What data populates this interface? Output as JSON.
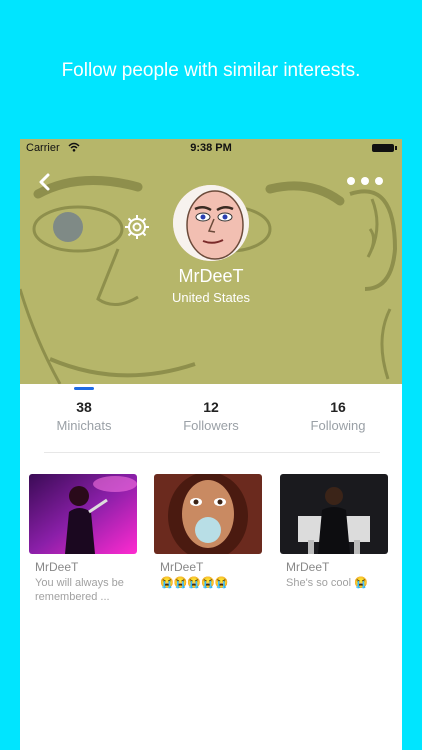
{
  "promo": {
    "text": "Follow people with similar interests."
  },
  "status_bar": {
    "carrier": "Carrier",
    "time": "9:38 PM"
  },
  "profile": {
    "username": "MrDeeT",
    "location": "United States"
  },
  "stats": [
    {
      "value": "38",
      "label": "Minichats"
    },
    {
      "value": "12",
      "label": "Followers"
    },
    {
      "value": "16",
      "label": "Following"
    }
  ],
  "posts": [
    {
      "author": "MrDeeT",
      "caption": "You will always be remembered ..."
    },
    {
      "author": "MrDeeT",
      "caption": "😭😭😭😭😭"
    },
    {
      "author": "MrDeeT",
      "caption": "She's so cool 😭"
    }
  ],
  "colors": {
    "background": "#00e5ff",
    "hero": "#b6b66a",
    "accent": "#1e6be6"
  },
  "icons": [
    "wifi-icon",
    "battery-icon",
    "back-icon",
    "more-icon",
    "settings-icon"
  ]
}
